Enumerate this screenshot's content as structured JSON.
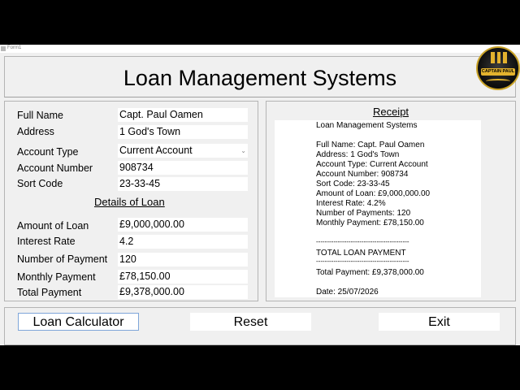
{
  "window": {
    "title": "Form1"
  },
  "header": {
    "title": "Loan Management Systems",
    "logo_text": "CAPTAIN PAUL"
  },
  "form": {
    "full_name_label": "Full Name",
    "full_name_value": "Capt. Paul Oamen",
    "address_label": "Address",
    "address_value": "1 God's Town",
    "account_type_label": "Account Type",
    "account_type_value": "Current Account",
    "account_number_label": "Account Number",
    "account_number_value": "908734",
    "sort_code_label": "Sort Code",
    "sort_code_value": "23-33-45",
    "loan_section_title": "Details of Loan",
    "amount_label": "Amount of Loan",
    "amount_value": "£9,000,000.00",
    "interest_label": "Interest Rate",
    "interest_value": "4.2",
    "payments_label": "Number of Payment",
    "payments_value": "120",
    "monthly_label": "Monthly Payment",
    "monthly_value": "£78,150.00",
    "total_label": "Total Payment",
    "total_value": "£9,378,000.00"
  },
  "receipt": {
    "title": "Receipt",
    "lines": [
      "Loan Management Systems",
      "Full Name: Capt. Paul Oamen",
      "Address: 1 God's Town",
      "Account Type: Current Account",
      "Account Number: 908734",
      "Sort Code: 23-33-45",
      "Amount of Loan: £9,000,000.00",
      "Interest Rate: 4.2%",
      "Number of Payments: 120",
      "Monthly Payment: £78,150.00",
      "-------------------------------------------",
      "TOTAL LOAN PAYMENT",
      "-------------------------------------------",
      "Total Payment: £9,378,000.00",
      "Date: 25/07/2026"
    ]
  },
  "buttons": {
    "calculator_label": "Loan Calculator",
    "reset_label": "Reset",
    "exit_label": "Exit"
  },
  "colors": {
    "window_bg": "#f0f0f0",
    "focus_border": "#7fa6d9",
    "logo_gold": "#e3b22e"
  }
}
